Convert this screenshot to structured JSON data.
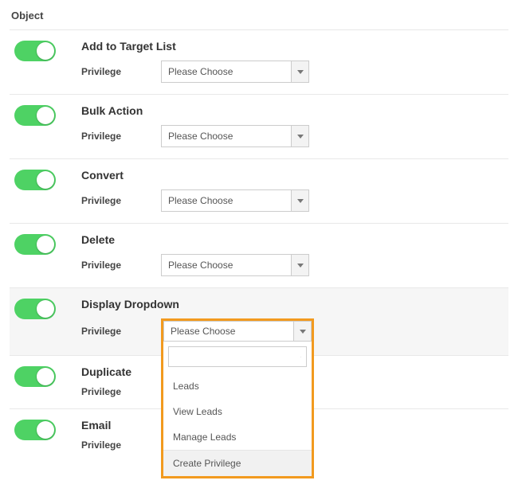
{
  "section_title": "Object",
  "field_label": "Privilege",
  "placeholder": "Please Choose",
  "rows": {
    "r0": {
      "title": "Add to Target List"
    },
    "r1": {
      "title": "Bulk Action"
    },
    "r2": {
      "title": "Convert"
    },
    "r3": {
      "title": "Delete"
    },
    "r4": {
      "title": "Display Dropdown"
    },
    "r5": {
      "title": "Duplicate"
    },
    "r6": {
      "title": "Email"
    }
  },
  "dropdown": {
    "options": {
      "o0": "Leads",
      "o1": "View Leads",
      "o2": "Manage Leads"
    },
    "action": "Create Privilege"
  }
}
